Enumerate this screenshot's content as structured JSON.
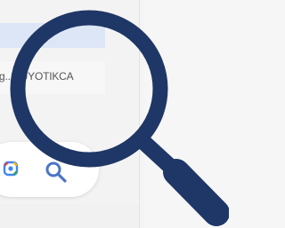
{
  "browser": {
    "url_visible_text": "g...EUYOTIKCA"
  },
  "icons": {
    "lens": "google-lens-icon",
    "search": "search-icon",
    "magnifier": "magnifying-glass-icon"
  },
  "colors": {
    "address_bar": "#dde6f7",
    "magnifier": "#1f3766",
    "search": "#4a74c9"
  }
}
